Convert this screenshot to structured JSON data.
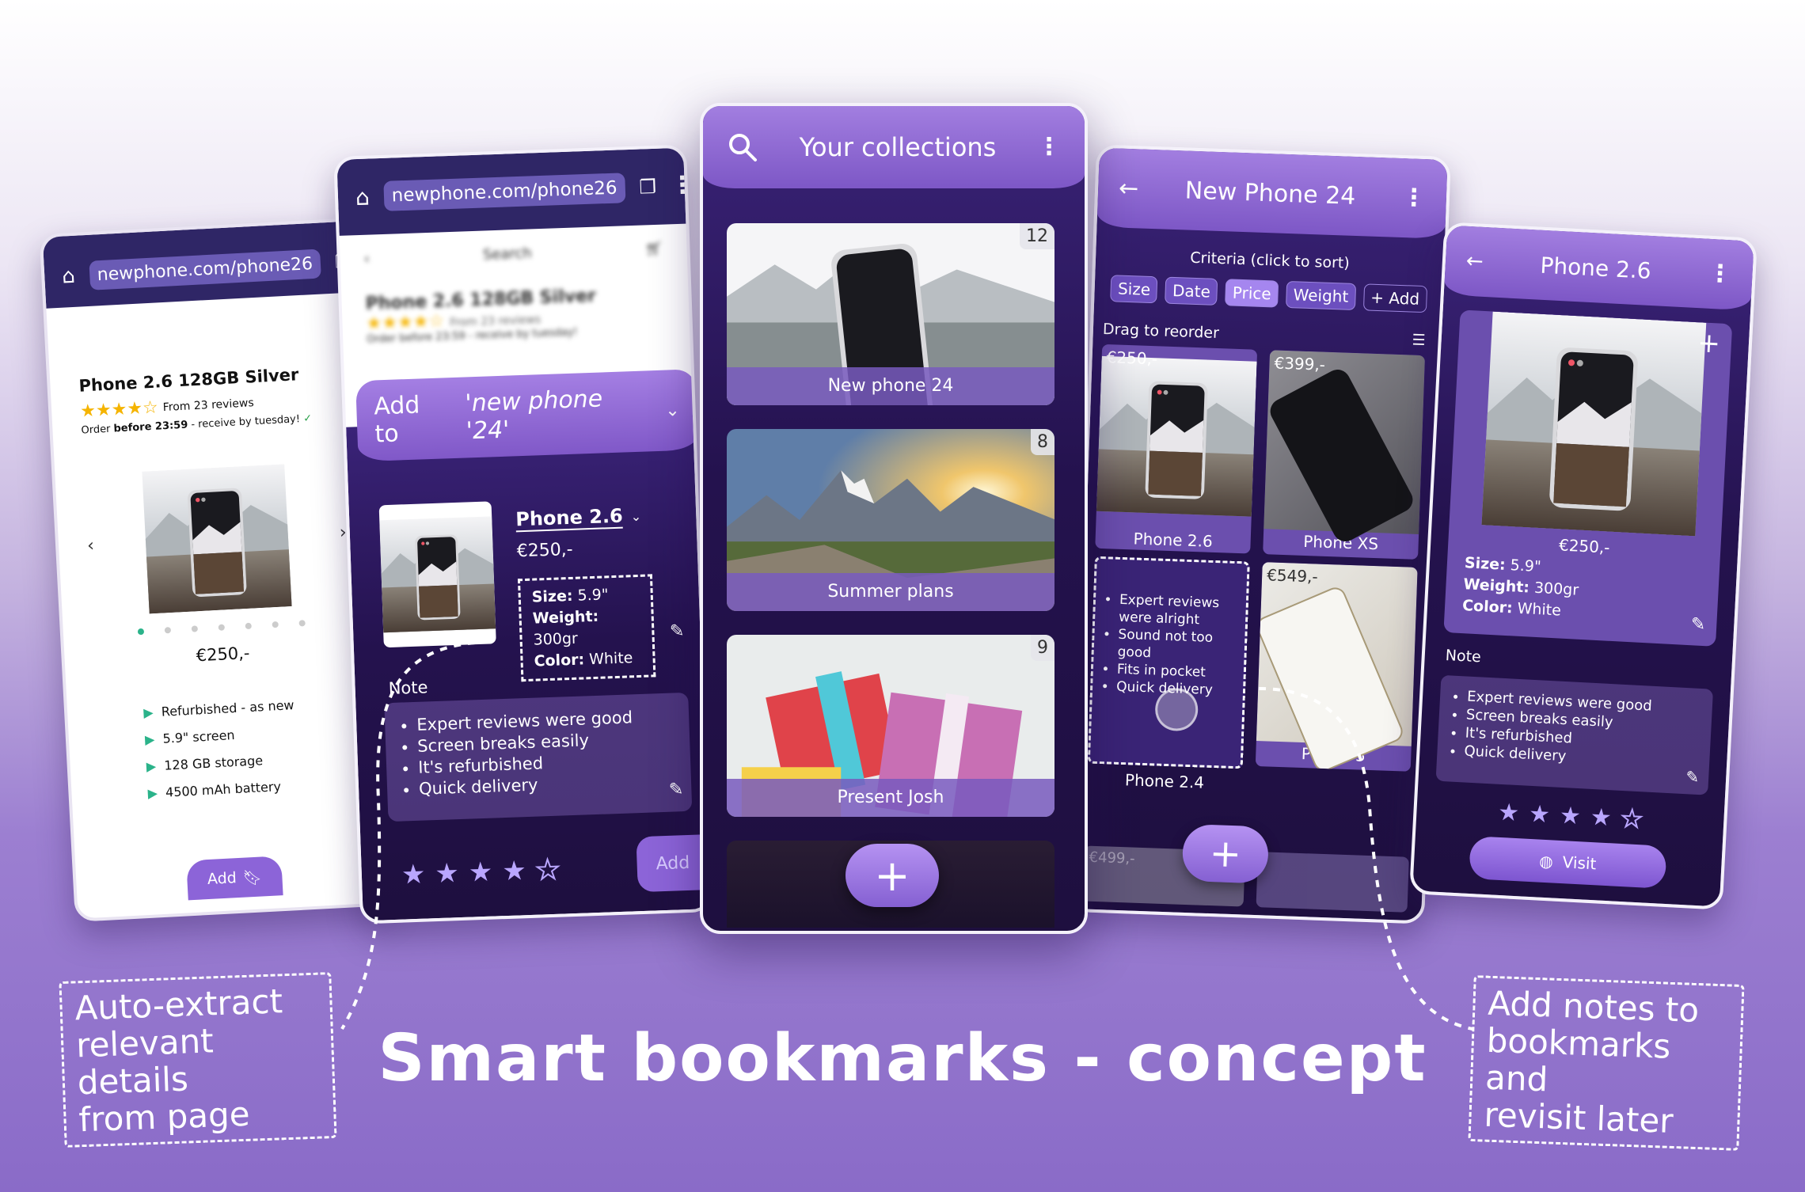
{
  "headline": "Smart bookmarks - concept",
  "callouts": {
    "left": [
      "Auto-extract",
      "relevant details",
      "from page"
    ],
    "right": [
      "Add notes to",
      "bookmarks and",
      "revisit later"
    ]
  },
  "screen1": {
    "url": "newphone.com/phone26",
    "product_title": "Phone 2.6 128GB Silver",
    "reviews": "From 23 reviews",
    "order_prefix": "Order ",
    "order_bold": "before 23:59",
    "order_suffix": " - receive by tuesday!",
    "price": "€250,-",
    "features": [
      "Refurbished - as new",
      "5.9\" screen",
      "128 GB storage",
      "4500 mAh battery"
    ],
    "add_button": "Add"
  },
  "screen2": {
    "url": "newphone.com/phone26",
    "search_placeholder": "Search",
    "product_title": "Phone 2.6 128GB Silver",
    "reviews": "From 23 reviews",
    "order_line": "Order before 23:59 - receive by tuesday!",
    "add_to_prefix": "Add to",
    "add_to_collection": "'new phone '24'",
    "product_name": "Phone 2.6",
    "price": "€250,-",
    "specs": {
      "size_label": "Size:",
      "size": "5.9\"",
      "weight_label": "Weight:",
      "weight": "300gr",
      "color_label": "Color:",
      "color": "White"
    },
    "note_label": "Note",
    "notes": [
      "Expert reviews were good",
      "Screen breaks easily",
      "It's refurbished",
      "Quick delivery"
    ],
    "rating": 4,
    "add_button": "Add"
  },
  "screen3": {
    "title": "Your collections",
    "collections": [
      {
        "name": "New phone 24",
        "count": "12"
      },
      {
        "name": "Summer plans",
        "count": "8"
      },
      {
        "name": "Present Josh",
        "count": "9"
      }
    ]
  },
  "screen4": {
    "title": "New Phone 24",
    "criteria_label": "Criteria (click to sort)",
    "chips": [
      "Size",
      "Date",
      "Price",
      "Weight",
      "+ Add"
    ],
    "active_chip": "Price",
    "drag_label": "Drag to reorder",
    "items": [
      {
        "name": "Phone 2.6",
        "price": "€250,-"
      },
      {
        "name": "Phone XS",
        "price": "€399,-"
      },
      {
        "name": "Phone 2.4",
        "notes": [
          "Expert reviews were alright",
          "Sound not too good",
          "Fits in pocket",
          "Quick delivery"
        ]
      },
      {
        "name": "Phone 5",
        "price": "€549,-"
      }
    ],
    "partial_price": "€499,-"
  },
  "screen5": {
    "title": "Phone 2.6",
    "price": "€250,-",
    "specs": {
      "size_label": "Size:",
      "size": "5.9\"",
      "weight_label": "Weight:",
      "weight": "300gr",
      "color_label": "Color:",
      "color": "White"
    },
    "note_label": "Note",
    "notes": [
      "Expert reviews were good",
      "Screen breaks easily",
      "It's refurbished",
      "Quick delivery"
    ],
    "rating": 4,
    "visit_button": "Visit"
  },
  "colors": {
    "accent": "#8c64d8",
    "dark": "#24124e",
    "topbar": "#7d57c6"
  }
}
